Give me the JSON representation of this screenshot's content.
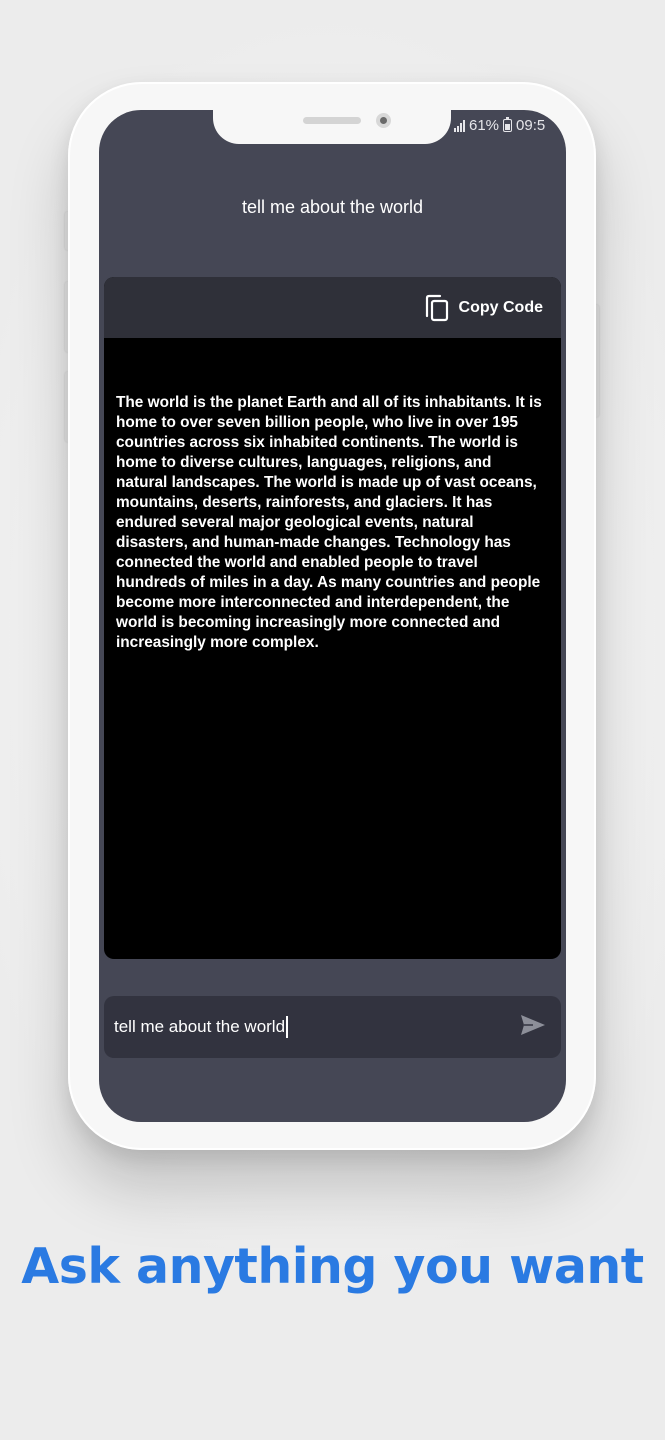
{
  "status_bar": {
    "battery_percent": "61%",
    "time": "09:5",
    "icons": [
      "signal-icon",
      "battery-icon"
    ]
  },
  "chat": {
    "title": "tell me about the world",
    "copy_label": "Copy Code",
    "response": "The world is the planet Earth and all of its inhabitants. It is home to over seven billion people, who live in over 195 countries across six inhabited continents. The world is home to diverse cultures, languages, religions, and natural landscapes. The world is made up of vast oceans, mountains, deserts, rainforests, and glaciers. It has endured several major geological events, natural disasters, and human-made changes. Technology has connected the world and enabled people to travel hundreds of miles in a day. As many countries and people become more interconnected and interdependent, the world is becoming increasingly more connected and increasingly more complex."
  },
  "input": {
    "value": "tell me about the world"
  },
  "tagline": "Ask anything you want",
  "colors": {
    "accent": "#2a7ae2",
    "screen_bg": "#454755",
    "card_header": "#2f3039",
    "input_bg": "#32333f",
    "response_bg": "#000000"
  }
}
